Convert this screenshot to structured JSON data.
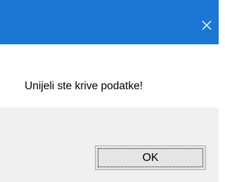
{
  "title_bar": {
    "close_icon": "close-icon",
    "color": "#1a78d4"
  },
  "message": {
    "text": "Unijeli ste krive podatke!"
  },
  "buttons": {
    "ok_label": "OK"
  },
  "colors": {
    "content_bg": "#ffffff",
    "footer_bg": "#f0f0f0",
    "button_bg": "#e5e5e5"
  }
}
